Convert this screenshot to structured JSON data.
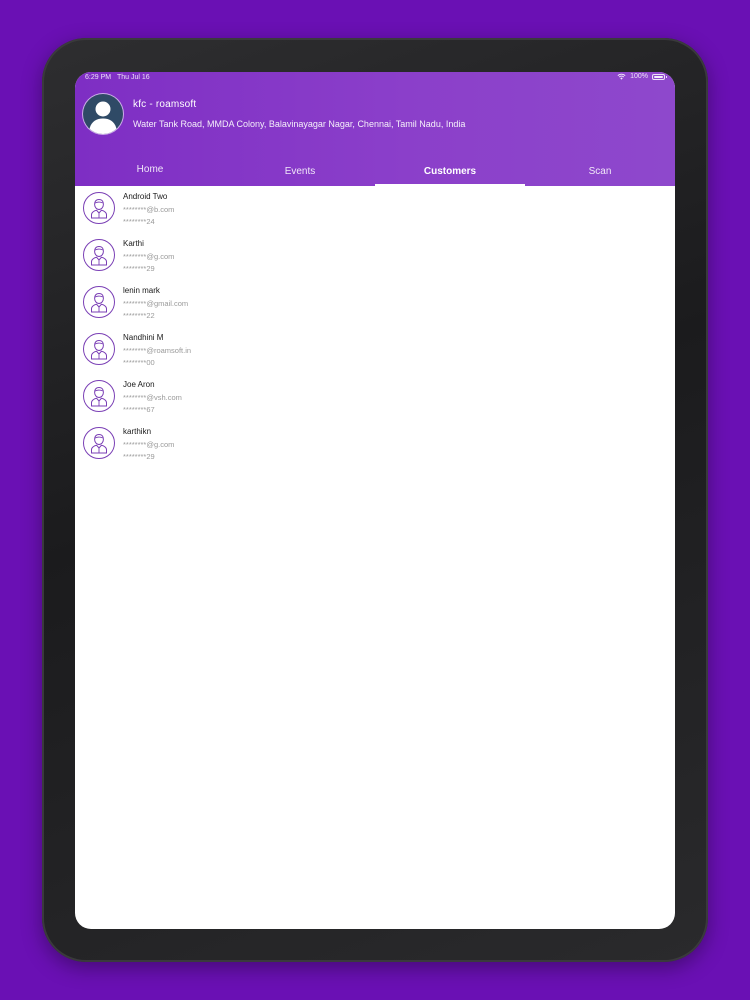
{
  "status_bar": {
    "time": "6:29 PM",
    "date": "Thu Jul 16",
    "battery": "100%"
  },
  "profile": {
    "name": "kfc - roamsoft",
    "address": "Water Tank Road, MMDA Colony, Balavinayagar Nagar, Chennai, Tamil Nadu, India"
  },
  "tabs": [
    {
      "label": "Home"
    },
    {
      "label": "Events"
    },
    {
      "label": "Customers"
    },
    {
      "label": "Scan"
    }
  ],
  "active_tab": "Customers",
  "customers": [
    {
      "name": "Android Two",
      "email": "********@b.com",
      "phone": "********24"
    },
    {
      "name": "Karthi",
      "email": "********@g.com",
      "phone": "********29"
    },
    {
      "name": "lenin mark",
      "email": "********@gmail.com",
      "phone": "********22"
    },
    {
      "name": "Nandhini M",
      "email": "********@roamsoft.in",
      "phone": "********00"
    },
    {
      "name": "Joe Aron",
      "email": "********@vsh.com",
      "phone": "********67"
    },
    {
      "name": "karthikn",
      "email": "********@g.com",
      "phone": "********29"
    }
  ],
  "colors": {
    "background": "#6a10b4",
    "header_start": "#7e2ec4",
    "header_end": "#8e48cc",
    "avatar_outline": "#7a3fb5",
    "device_frame": "#1b1b1d"
  },
  "icons": {
    "profile": "person-silhouette-icon",
    "customer": "user-outline-icon",
    "wifi": "wifi-icon",
    "battery": "battery-icon"
  }
}
